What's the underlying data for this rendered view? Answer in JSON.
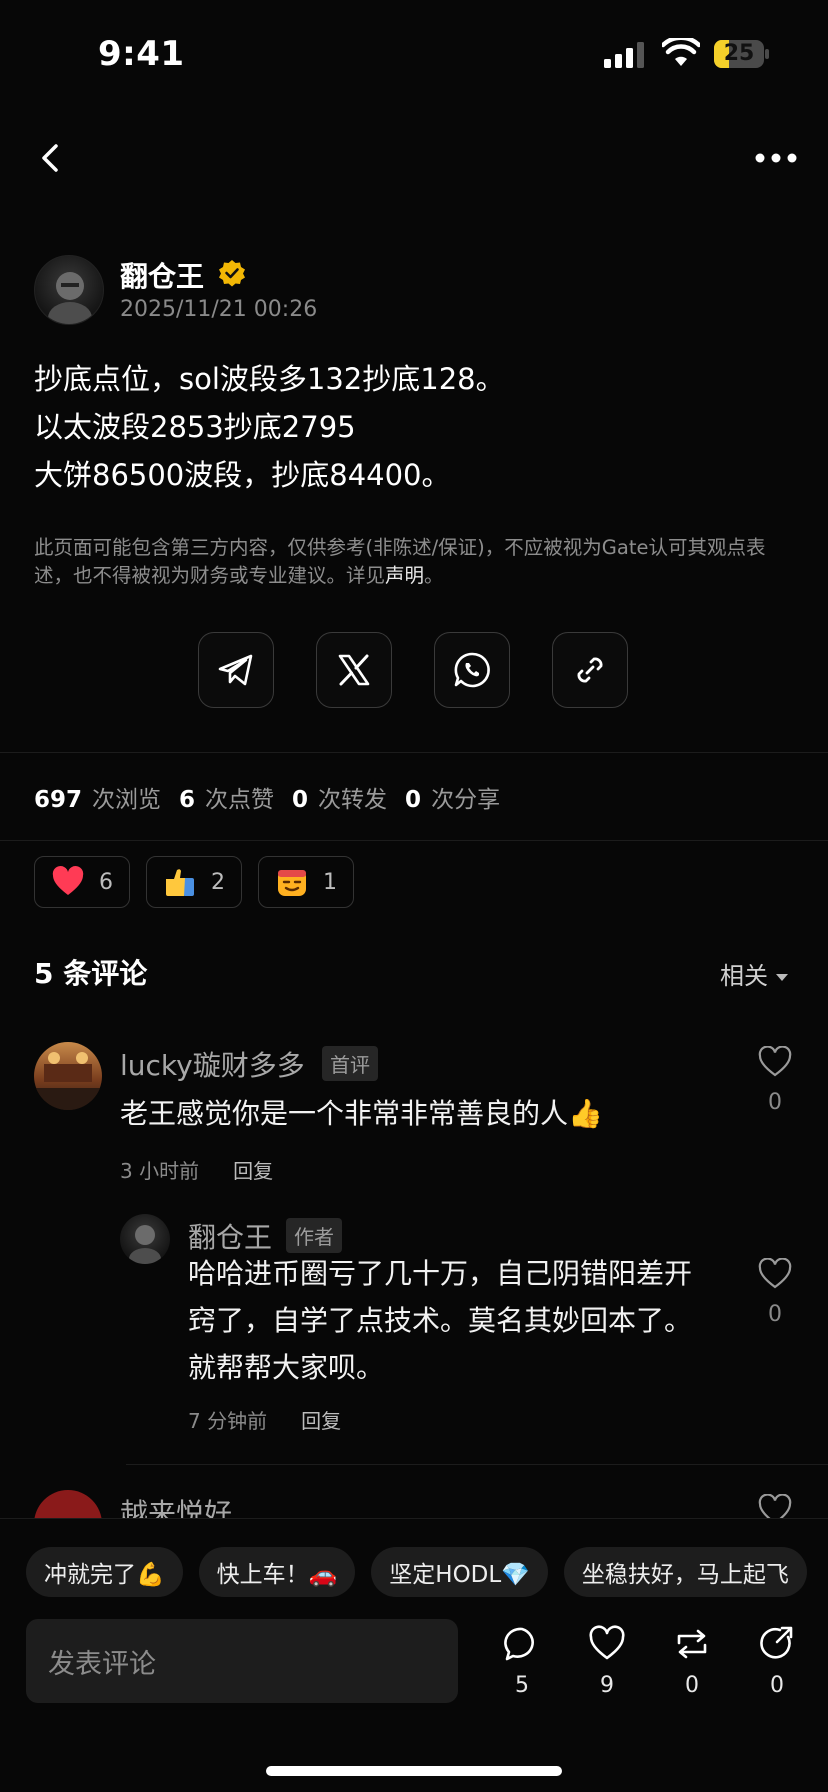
{
  "status_bar": {
    "time": "9:41",
    "battery": "25"
  },
  "post": {
    "author_name": "翻仓王",
    "timestamp": "2025/11/21 00:26",
    "lines": [
      "抄底点位，sol波段多132抄底128。",
      "以太波段2853抄底2795",
      "大饼86500波段，抄底84400。"
    ],
    "disclaimer_text": "此页面可能包含第三方内容，仅供参考(非陈述/保证)，不应被视为Gate认可其观点表述，也不得被视为财务或专业建议。详见",
    "disclaimer_link": "声明",
    "disclaimer_end": "。"
  },
  "share_buttons": [
    "telegram-icon",
    "x-icon",
    "whatsapp-icon",
    "link-icon"
  ],
  "stats": [
    {
      "num": "697",
      "label": "次浏览"
    },
    {
      "num": "6",
      "label": "次点赞"
    },
    {
      "num": "0",
      "label": "次转发"
    },
    {
      "num": "0",
      "label": "次分享"
    }
  ],
  "reactions": [
    {
      "icon": "heart-icon",
      "count": "6"
    },
    {
      "icon": "thumbs-up-icon",
      "count": "2"
    },
    {
      "icon": "money-face-icon",
      "count": "1"
    }
  ],
  "comments_header": {
    "title": "5 条评论",
    "sort": "相关"
  },
  "comments": [
    {
      "name": "lucky璇财多多",
      "tag": "首评",
      "text": "老王感觉你是一个非常非常善良的人👍",
      "time": "3 小时前",
      "reply": "回复",
      "likes": "0"
    },
    {
      "name": "翻仓王",
      "tag": "作者",
      "lines": [
        "哈哈进币圈亏了几十万，自己阴错阳差开",
        "窍了，自学了点技术。莫名其妙回本了。",
        "就帮帮大家呗。"
      ],
      "time": "7 分钟前",
      "reply": "回复",
      "likes": "0"
    },
    {
      "name": "越来悦好"
    }
  ],
  "quick_replies": [
    "冲就完了💪",
    "快上车！🚗",
    "坚定HODL💎",
    "坐稳扶好，马上起飞"
  ],
  "bottom_bar": {
    "input_placeholder": "发表评论",
    "comments": "5",
    "likes": "9",
    "reposts": "0",
    "shares": "0"
  }
}
